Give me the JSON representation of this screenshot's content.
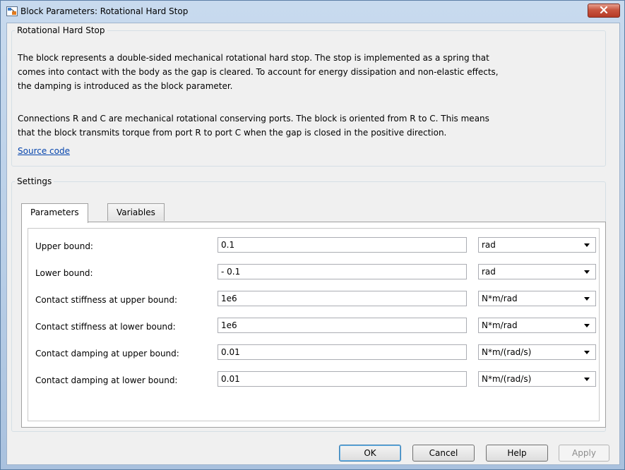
{
  "window": {
    "title": "Block Parameters: Rotational Hard Stop"
  },
  "description": {
    "group_title": "Rotational Hard Stop",
    "paragraph1_lines": [
      "The block represents a double-sided mechanical rotational hard stop. The stop is implemented as a spring that",
      "comes into contact with the body as the gap is cleared. To account for energy dissipation and non-elastic effects,",
      "the damping is introduced as the block parameter."
    ],
    "paragraph2_lines": [
      "Connections R and C are mechanical rotational conserving ports. The block is oriented from R to C. This means",
      "that the block transmits torque from port R to port C when the gap is closed in the positive direction."
    ],
    "source_link": "Source code"
  },
  "settings": {
    "group_title": "Settings",
    "tabs": [
      {
        "label": "Parameters",
        "active": true
      },
      {
        "label": "Variables",
        "active": false
      }
    ],
    "parameters": [
      {
        "label": "Upper bound:",
        "value": "0.1",
        "unit": "rad"
      },
      {
        "label": "Lower bound:",
        "value": "- 0.1",
        "unit": "rad"
      },
      {
        "label": "Contact stiffness at upper bound:",
        "value": "1e6",
        "unit": "N*m/rad"
      },
      {
        "label": "Contact stiffness at lower bound:",
        "value": "1e6",
        "unit": "N*m/rad"
      },
      {
        "label": "Contact damping at upper bound:",
        "value": "0.01",
        "unit": "N*m/(rad/s)"
      },
      {
        "label": "Contact damping at lower bound:",
        "value": "0.01",
        "unit": "N*m/(rad/s)"
      }
    ]
  },
  "buttons": {
    "ok": "OK",
    "cancel": "Cancel",
    "help": "Help",
    "apply": "Apply"
  }
}
